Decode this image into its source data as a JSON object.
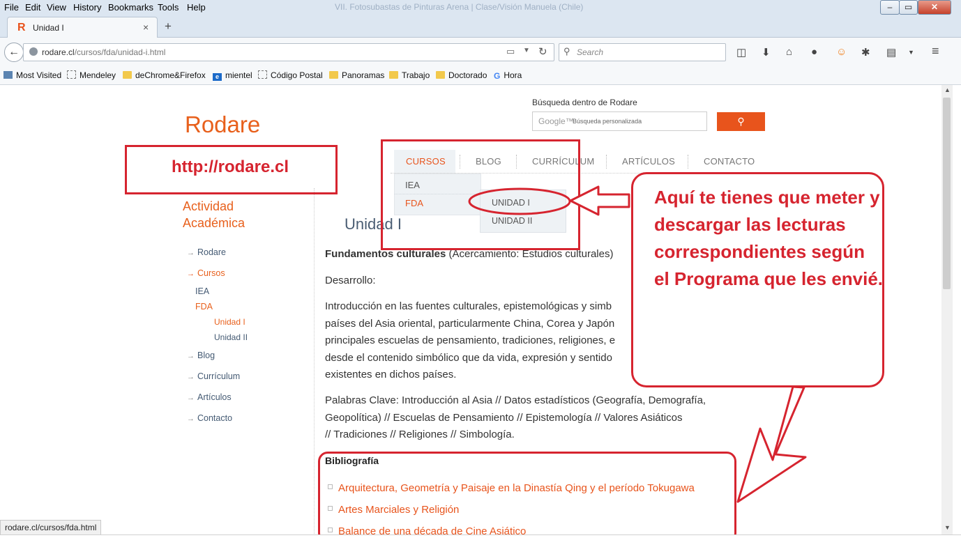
{
  "browser": {
    "menu": [
      "File",
      "Edit",
      "View",
      "History",
      "Bookmarks",
      "Tools",
      "Help"
    ],
    "window_title": "VII. Fotosubastas de Pinturas Arena | Clase/Visión Manuela (Chile)",
    "tab_title": "Unidad I",
    "url_domain": "rodare.cl",
    "url_path": "/cursos/fda/unidad-i.html",
    "search_placeholder": "Search",
    "bookmarks": [
      "Most Visited",
      "Mendeley",
      "deChrome&Firefox",
      "mientel",
      "Código Postal",
      "Panoramas",
      "Trabajo",
      "Doctorado",
      "Hora"
    ],
    "status_text": "rodare.cl/cursos/fda.html"
  },
  "site": {
    "logo": "Rodare",
    "search_label": "Búsqueda dentro de Rodare",
    "search_google": "Google™",
    "search_placeholder": "Búsqueda personalizada",
    "nav": [
      "CURSOS",
      "BLOG",
      "CURRÍCULUM",
      "ARTÍCULOS",
      "CONTACTO"
    ],
    "dropdown": [
      "IEA",
      "FDA"
    ],
    "subdropdown": [
      "UNIDAD I",
      "UNIDAD II"
    ]
  },
  "sidebar": {
    "title_line1": "Actividad",
    "title_line2": "Académica",
    "items": [
      "Rodare",
      "Cursos",
      "IEA",
      "FDA",
      "Unidad I",
      "Unidad II",
      "Blog",
      "Currículum",
      "Artículos",
      "Contacto"
    ]
  },
  "content": {
    "title": "Unidad I",
    "intro_bold": "Fundamentos culturales",
    "intro_rest": " (Acercamiento: Estudios culturales)",
    "desarrollo": "Desarrollo:",
    "p1": [
      "Introducción en las fuentes culturales, epistemológicas y simb",
      "países del Asia oriental, particularmente China, Corea y Japón",
      "principales escuelas de pensamiento, tradiciones, religiones, e",
      "desde el contenido simbólico que da vida, expresión y sentido",
      "existentes en dichos países."
    ],
    "p2": [
      "Palabras Clave: Introducción al Asia // Datos estadísticos (Geografía, Demografía,",
      "Geopolítica) // Escuelas de Pensamiento // Epistemología // Valores Asiáticos",
      "// Tradiciones // Religiones // Simbología."
    ],
    "bib_title": "Bibliografía",
    "bibliography": [
      "Arquitectura, Geometría y Paisaje en la Dinastía Qing y el período Tokugawa",
      "Artes Marciales y Religión",
      "Balance de una década de Cine Asiático"
    ]
  },
  "annotations": {
    "url_label": "http://rodare.cl",
    "callout": "Aquí te tienes que meter y descargar las lecturas correspondientes según el Programa que les envié.",
    "color": "#d6242f"
  },
  "colors": {
    "accent": "#e8601c",
    "annotation": "#d6242f"
  }
}
